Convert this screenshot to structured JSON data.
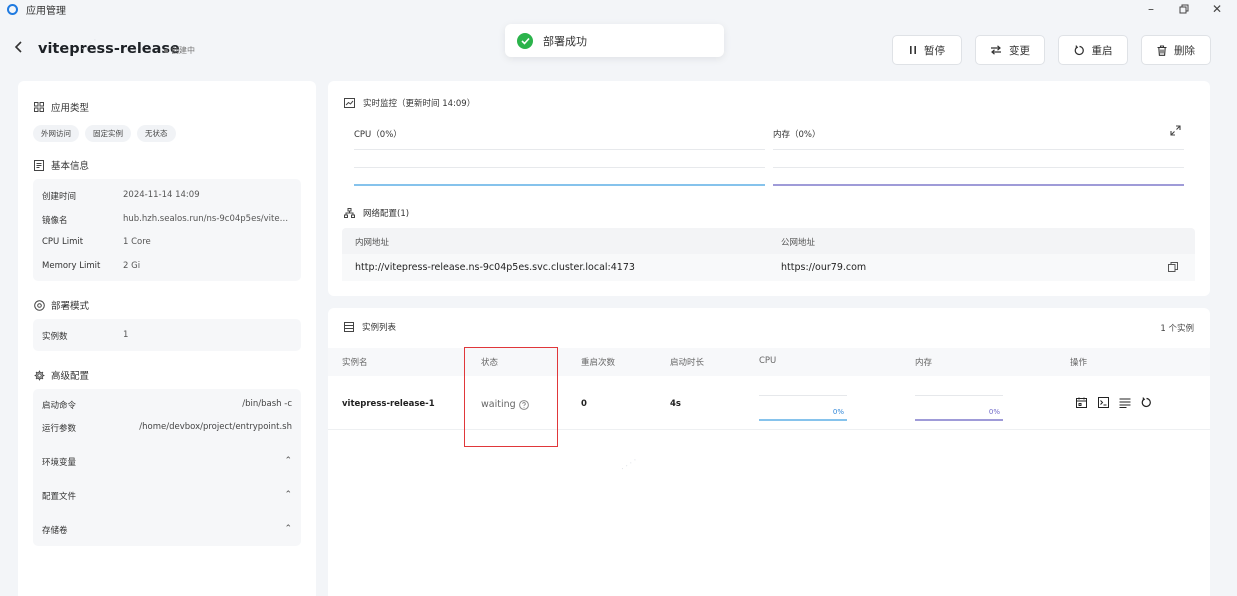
{
  "window": {
    "title": "应用管理"
  },
  "header": {
    "app_name": "vitepress-release",
    "status": "创建中"
  },
  "toast": {
    "message": "部署成功"
  },
  "actions": {
    "pause": "暂停",
    "change": "变更",
    "restart": "重启",
    "delete": "删除"
  },
  "left": {
    "app_type_title": "应用类型",
    "tags": [
      "外网访问",
      "固定实例",
      "无状态"
    ],
    "basic_title": "基本信息",
    "basic": [
      {
        "k": "创建时间",
        "v": "2024-11-14 14:09"
      },
      {
        "k": "镜像名",
        "v": "hub.hzh.sealos.run/ns-9c04p5es/vitepres..."
      },
      {
        "k": "CPU Limit",
        "v": "1 Core"
      },
      {
        "k": "Memory Limit",
        "v": "2 Gi"
      }
    ],
    "deploy_title": "部署模式",
    "instances_label": "实例数",
    "instances_value": "1",
    "advanced_title": "高级配置",
    "startup_cmd_label": "启动命令",
    "startup_cmd": "/bin/bash -c",
    "run_args_label": "运行参数",
    "run_args": "/home/devbox/project/entrypoint.sh",
    "env_label": "环境变量",
    "config_label": "配置文件",
    "storage_label": "存储卷"
  },
  "monitor": {
    "title": "实时监控（更新时间 14:09）",
    "cpu_label": "CPU（0%）",
    "mem_label": "内存（0%）",
    "cpu_color": "#86c3ec",
    "mem_color": "#9f9bd8"
  },
  "network": {
    "title": "网络配置(1)",
    "internal_header": "内网地址",
    "public_header": "公网地址",
    "internal": "http://vitepress-release.ns-9c04p5es.svc.cluster.local:4173",
    "public": "https://our79.com"
  },
  "instances": {
    "title": "实例列表",
    "count": "1 个实例",
    "headers": [
      "实例名",
      "状态",
      "重启次数",
      "启动时长",
      "CPU",
      "内存",
      "操作"
    ],
    "rows": [
      {
        "name": "vitepress-release-1",
        "status": "waiting",
        "restarts": "0",
        "uptime": "4s",
        "cpu": "0%",
        "mem": "0%"
      }
    ]
  }
}
